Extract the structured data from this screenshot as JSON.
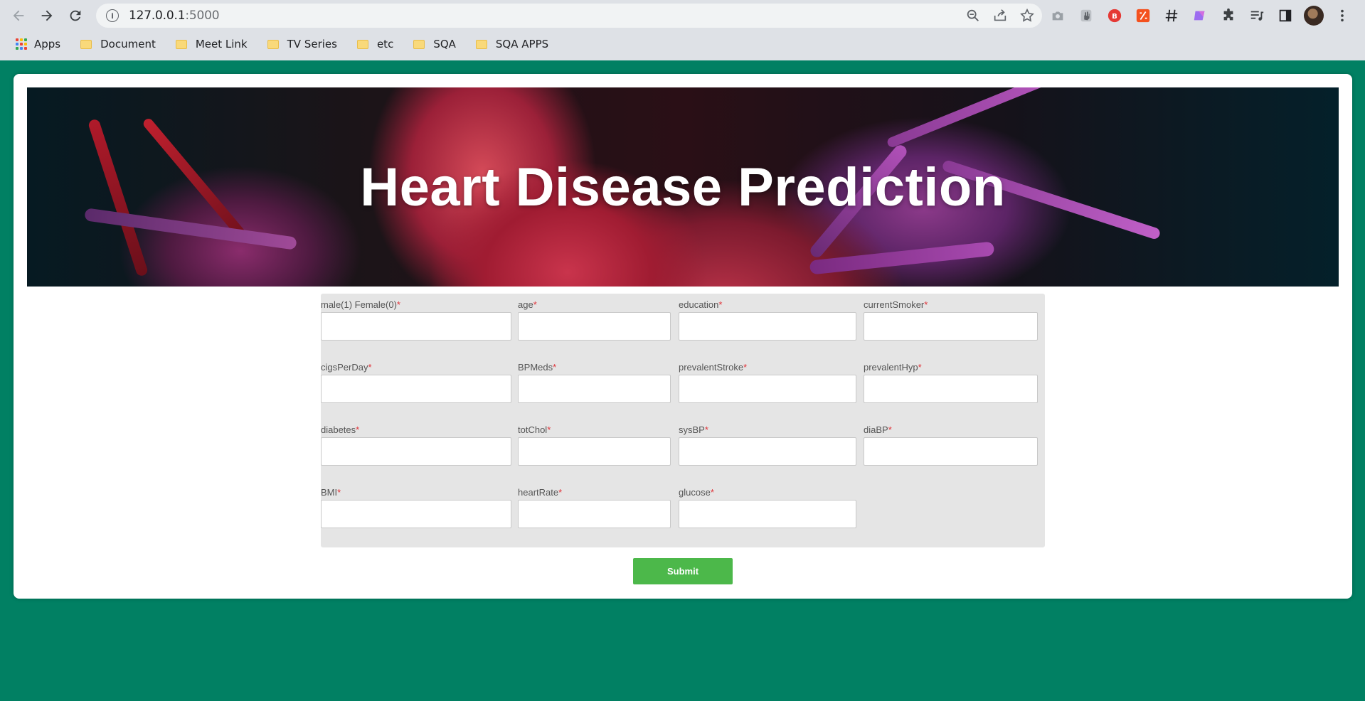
{
  "browser": {
    "url_host": "127.0.0.1",
    "url_port": ":5000",
    "bookmarks": [
      {
        "label": "Apps",
        "icon": "apps-grid-icon"
      },
      {
        "label": "Document",
        "icon": "folder-icon"
      },
      {
        "label": "Meet Link",
        "icon": "folder-icon"
      },
      {
        "label": "TV Series",
        "icon": "folder-icon"
      },
      {
        "label": "etc",
        "icon": "folder-icon"
      },
      {
        "label": "SQA",
        "icon": "folder-icon"
      },
      {
        "label": "SQA APPS",
        "icon": "folder-icon"
      }
    ],
    "extensions": [
      "camera-icon",
      "shield-hand-icon",
      "red-b-icon",
      "orange-slash-icon",
      "hash-icon",
      "purple-gem-icon",
      "puzzle-icon",
      "playlist-icon",
      "side-panel-icon"
    ]
  },
  "page": {
    "title": "Heart Disease Prediction",
    "required_mark": "*",
    "fields": [
      {
        "label": "male(1) Female(0)"
      },
      {
        "label": "age"
      },
      {
        "label": "education"
      },
      {
        "label": "currentSmoker"
      },
      {
        "label": "cigsPerDay"
      },
      {
        "label": "BPMeds"
      },
      {
        "label": "prevalentStroke"
      },
      {
        "label": "prevalentHyp"
      },
      {
        "label": "diabetes"
      },
      {
        "label": "totChol"
      },
      {
        "label": "sysBP"
      },
      {
        "label": "diaBP"
      },
      {
        "label": "BMI"
      },
      {
        "label": "heartRate"
      },
      {
        "label": "glucose"
      }
    ],
    "submit_label": "Submit"
  },
  "colors": {
    "background": "#018063",
    "submit": "#4cb84a",
    "required": "#e0343a"
  }
}
